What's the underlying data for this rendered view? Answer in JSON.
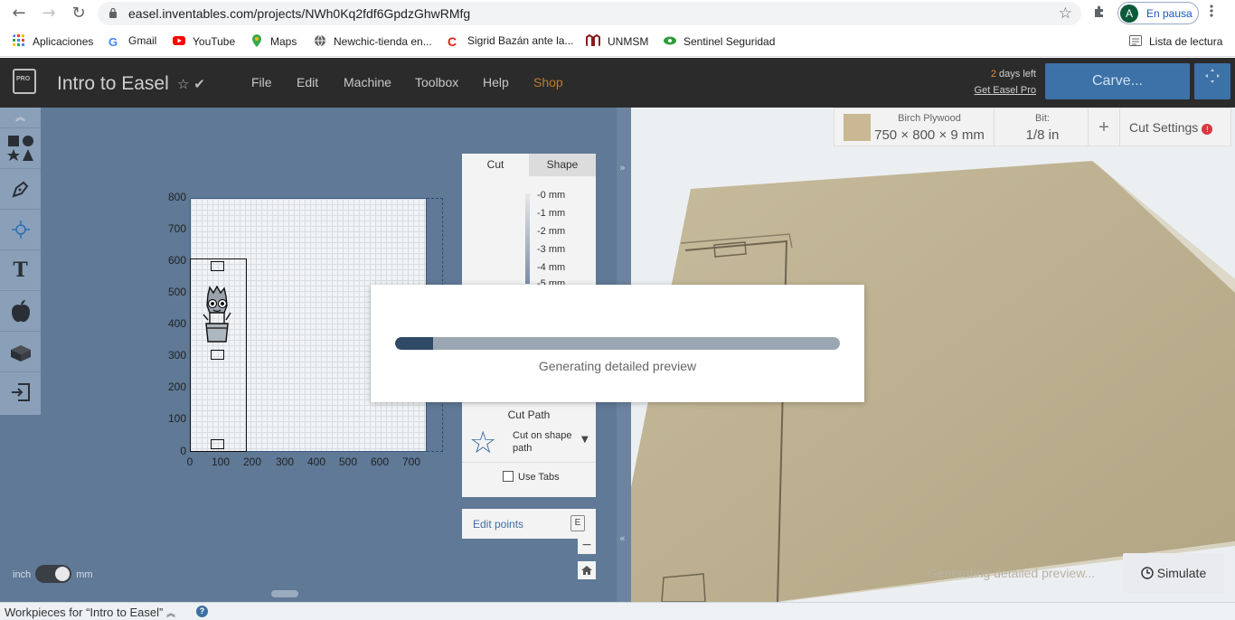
{
  "browser": {
    "url": "easel.inventables.com/projects/NWh0Kq2fdf6GpdzGhwRMfg",
    "profile_initial": "A",
    "profile_status": "En pausa",
    "reading_list": "Lista de lectura",
    "bookmarks": [
      {
        "label": "Aplicaciones",
        "icon": "apps-grid-icon",
        "color": "#4285f4"
      },
      {
        "label": "Gmail",
        "icon": "google-icon",
        "color": "#4285f4"
      },
      {
        "label": "YouTube",
        "icon": "youtube-icon",
        "color": "#ff0000"
      },
      {
        "label": "Maps",
        "icon": "maps-pin-icon",
        "color": "#34a853"
      },
      {
        "label": "Newchic-tienda en...",
        "icon": "globe-icon",
        "color": "#5f6368"
      },
      {
        "label": "Sigrid Bazán ante la...",
        "icon": "c-logo-icon",
        "color": "#e0201a"
      },
      {
        "label": "UNMSM",
        "icon": "unmsm-logo-icon",
        "color": "#8b1a1a"
      },
      {
        "label": "Sentinel Seguridad",
        "icon": "eye-icon",
        "color": "#2e9b3a"
      }
    ]
  },
  "header": {
    "logo_text": "PRO",
    "project_title": "Intro to Easel",
    "menu": [
      "File",
      "Edit",
      "Machine",
      "Toolbox",
      "Help",
      "Shop"
    ],
    "shop_color": "#c17a2a",
    "days_left_num": "2",
    "days_left_text": " days left",
    "get_pro": "Get Easel Pro",
    "carve_label": "Carve..."
  },
  "canvas": {
    "y_ticks": [
      "800",
      "700",
      "600",
      "500",
      "400",
      "300",
      "200",
      "100",
      "0"
    ],
    "x_ticks": [
      "0",
      "100",
      "200",
      "300",
      "400",
      "500",
      "600",
      "700"
    ]
  },
  "cut_panel": {
    "tab_cut": "Cut",
    "tab_shape": "Shape",
    "depth_labels": [
      "-0 mm",
      "-1 mm",
      "-2 mm",
      "-3 mm",
      "-4 mm",
      "-5 mm"
    ],
    "cut_path_title": "Cut Path",
    "cut_path_option": "Cut on shape path",
    "use_tabs": "Use Tabs",
    "edit_points": "Edit points",
    "edit_points_key": "E"
  },
  "units": {
    "left": "inch",
    "right": "mm"
  },
  "preview": {
    "material_name": "Birch Plywood",
    "material_dims": "750 × 800 × 9 mm",
    "bit_label": "Bit:",
    "bit_value": "1/8 in",
    "cut_settings": "Cut Settings",
    "status": "Generating detailed preview...",
    "simulate": "Simulate"
  },
  "workpieces": {
    "label": "Workpieces for “Intro to Easel”"
  },
  "modal": {
    "progress": 0.085,
    "message": "Generating detailed preview"
  }
}
